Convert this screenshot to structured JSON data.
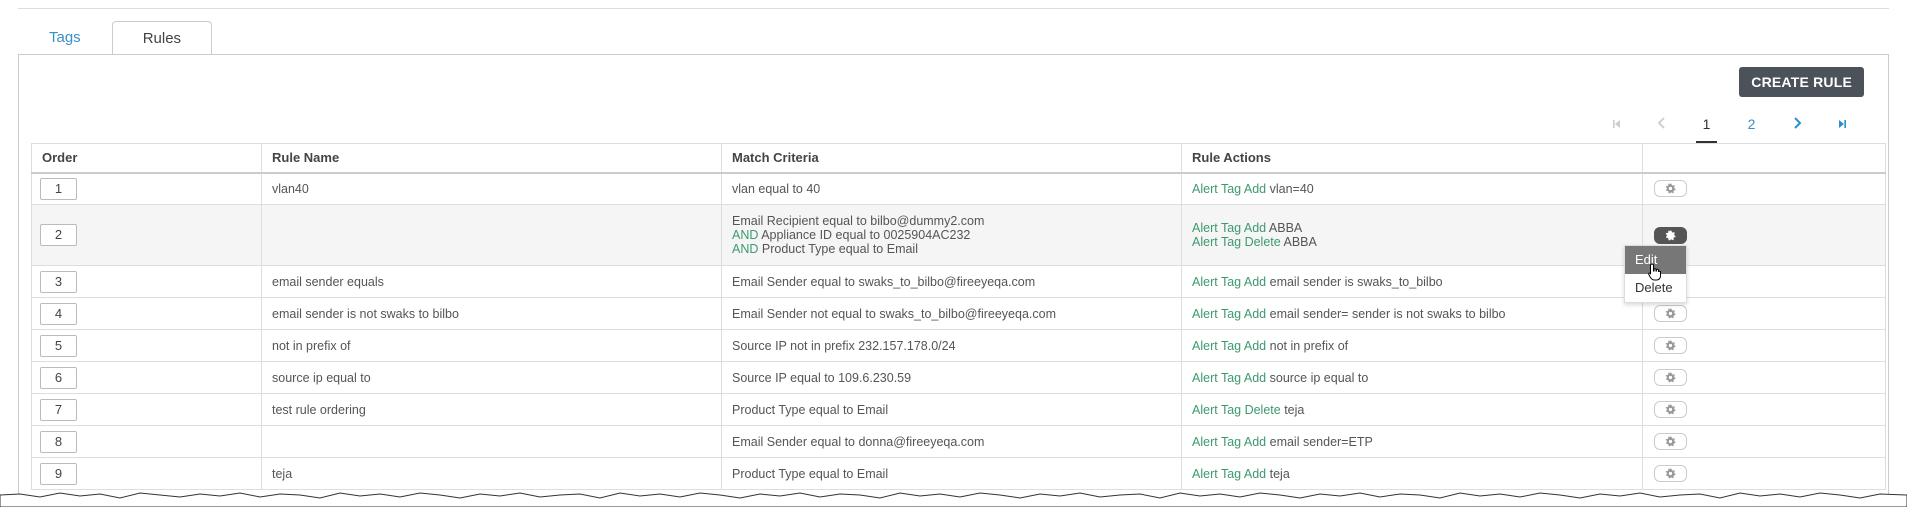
{
  "tabs": [
    {
      "label": "Tags",
      "active": false
    },
    {
      "label": "Rules",
      "active": true
    }
  ],
  "toolbar": {
    "create_label": "CREATE RULE"
  },
  "pager": {
    "pages": [
      "1",
      "2"
    ],
    "current": "1"
  },
  "table": {
    "headers": [
      "Order",
      "Rule Name",
      "Match Criteria",
      "Rule Actions",
      ""
    ],
    "rows": [
      {
        "order": "1",
        "name": "vlan40",
        "criteria": [
          {
            "kw": "",
            "text": "vlan equal to 40"
          }
        ],
        "actions": [
          {
            "kw": "Alert Tag Add",
            "text": " vlan=40"
          }
        ]
      },
      {
        "order": "2",
        "name": "",
        "criteria": [
          {
            "kw": "",
            "text": "Email Recipient equal to bilbo@dummy2.com"
          },
          {
            "kw": "AND",
            "text": " Appliance ID equal to 0025904AC232"
          },
          {
            "kw": "AND",
            "text": " Product Type equal to Email"
          }
        ],
        "actions": [
          {
            "kw": "Alert Tag Add",
            "text": " ABBA"
          },
          {
            "kw": "Alert Tag Delete",
            "text": " ABBA"
          }
        ]
      },
      {
        "order": "3",
        "name": "email sender equals",
        "criteria": [
          {
            "kw": "",
            "text": "Email Sender equal to swaks_to_bilbo@fireeyeqa.com"
          }
        ],
        "actions": [
          {
            "kw": "Alert Tag Add",
            "text": " email sender is swaks_to_bilbo"
          }
        ]
      },
      {
        "order": "4",
        "name": "email sender is not swaks to bilbo",
        "criteria": [
          {
            "kw": "",
            "text": "Email Sender not equal to swaks_to_bilbo@fireeyeqa.com"
          }
        ],
        "actions": [
          {
            "kw": "Alert Tag Add",
            "text": " email sender= sender is not swaks to bilbo"
          }
        ]
      },
      {
        "order": "5",
        "name": "not in prefix of",
        "criteria": [
          {
            "kw": "",
            "text": "Source IP not in prefix 232.157.178.0/24"
          }
        ],
        "actions": [
          {
            "kw": "Alert Tag Add",
            "text": " not in prefix of"
          }
        ]
      },
      {
        "order": "6",
        "name": "source ip equal to",
        "criteria": [
          {
            "kw": "",
            "text": "Source IP equal to 109.6.230.59"
          }
        ],
        "actions": [
          {
            "kw": "Alert Tag Add",
            "text": " source ip equal to"
          }
        ]
      },
      {
        "order": "7",
        "name": "test rule ordering",
        "criteria": [
          {
            "kw": "",
            "text": "Product Type equal to Email"
          }
        ],
        "actions": [
          {
            "kw": "Alert Tag Delete",
            "text": " teja"
          }
        ]
      },
      {
        "order": "8",
        "name": "",
        "criteria": [
          {
            "kw": "",
            "text": "Email Sender equal to donna@fireeyeqa.com"
          }
        ],
        "actions": [
          {
            "kw": "Alert Tag Add",
            "text": " email sender=ETP"
          }
        ]
      },
      {
        "order": "9",
        "name": "teja",
        "criteria": [
          {
            "kw": "",
            "text": "Product Type equal to Email"
          }
        ],
        "actions": [
          {
            "kw": "Alert Tag Add",
            "text": " teja"
          }
        ]
      }
    ]
  },
  "menu": {
    "items": [
      "Edit",
      "Delete"
    ],
    "hover": "Edit"
  },
  "colors": {
    "keyword": "#3d9a6e",
    "link": "#3a8fc7",
    "button": "#4b525a"
  },
  "icons": {
    "row_action": "gear-icon",
    "first": "first-page-icon",
    "prev": "prev-page-icon",
    "next": "next-page-icon",
    "last": "last-page-icon"
  }
}
